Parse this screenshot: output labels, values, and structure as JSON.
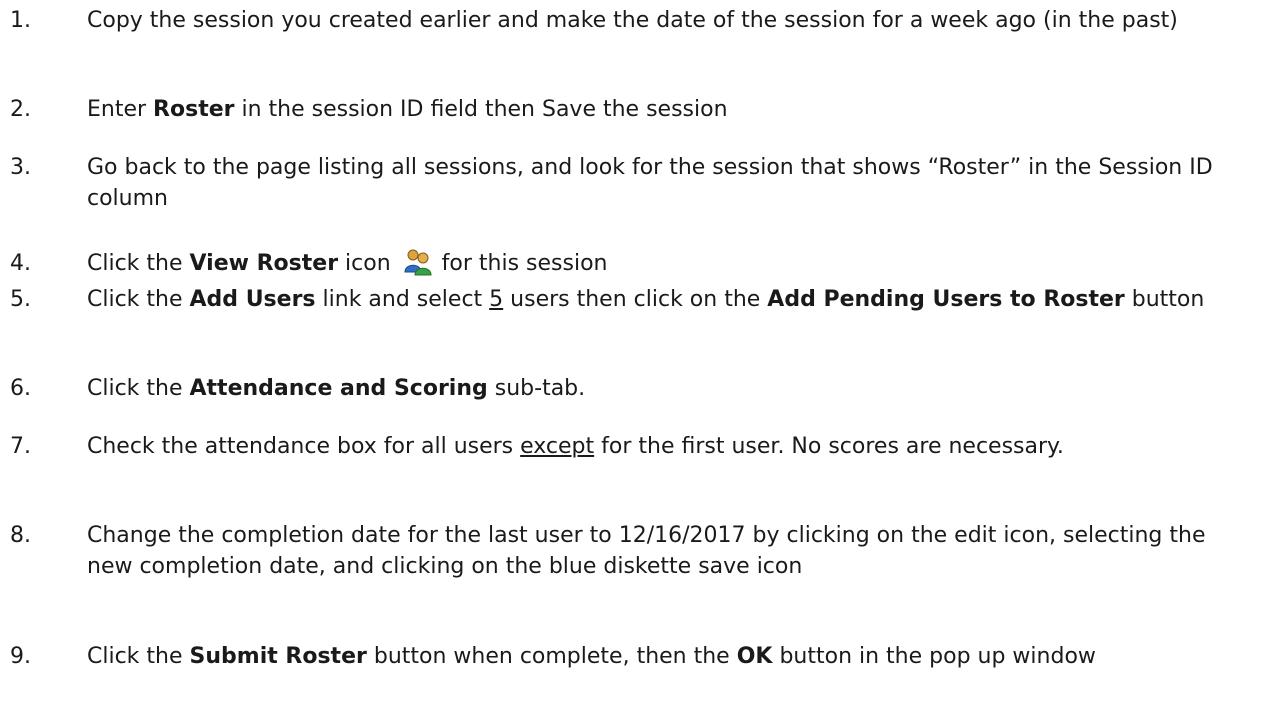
{
  "steps": [
    {
      "number": "1.",
      "parts": {
        "p1": "Copy the session you created earlier and make the date of the session for a week ago (in the past)"
      }
    },
    {
      "number": "2.",
      "parts": {
        "p1": "Enter ",
        "b1": "Roster",
        "p2": " in the session ID field then Save the session"
      }
    },
    {
      "number": "3.",
      "parts": {
        "p1": "Go back to the page listing all sessions, and look for the session that shows “Roster” in the Session ID column"
      }
    },
    {
      "number": "4.",
      "parts": {
        "p1": "Click the ",
        "b1": "View Roster",
        "p2": " icon ",
        "icon": "view-roster-icon",
        "p3": "for this session"
      }
    },
    {
      "number": "5.",
      "parts": {
        "p1": "Click the ",
        "b1": "Add Users",
        "p2": " link and select ",
        "u1": "5",
        "p3": " users then click on the ",
        "b2": "Add Pending Users to Roster",
        "p4": " button"
      }
    },
    {
      "number": "6.",
      "parts": {
        "p1": "Click the ",
        "b1": "Attendance and Scoring",
        "p2": " sub-tab."
      }
    },
    {
      "number": "7.",
      "parts": {
        "p1": "Check the attendance box for all users ",
        "u1": "except",
        "p2": " for the first user.  No scores are necessary."
      }
    },
    {
      "number": "8.",
      "parts": {
        "p1": "Change the completion date for the last user to 12/16/2017 by clicking on the edit icon, selecting the new completion date, and clicking on the blue diskette save icon"
      }
    },
    {
      "number": "9.",
      "parts": {
        "p1": "Click the ",
        "b1": "Submit Roster",
        "p2": " button when complete, then the ",
        "b2": "OK",
        "p3": " button in the pop up window"
      }
    }
  ]
}
